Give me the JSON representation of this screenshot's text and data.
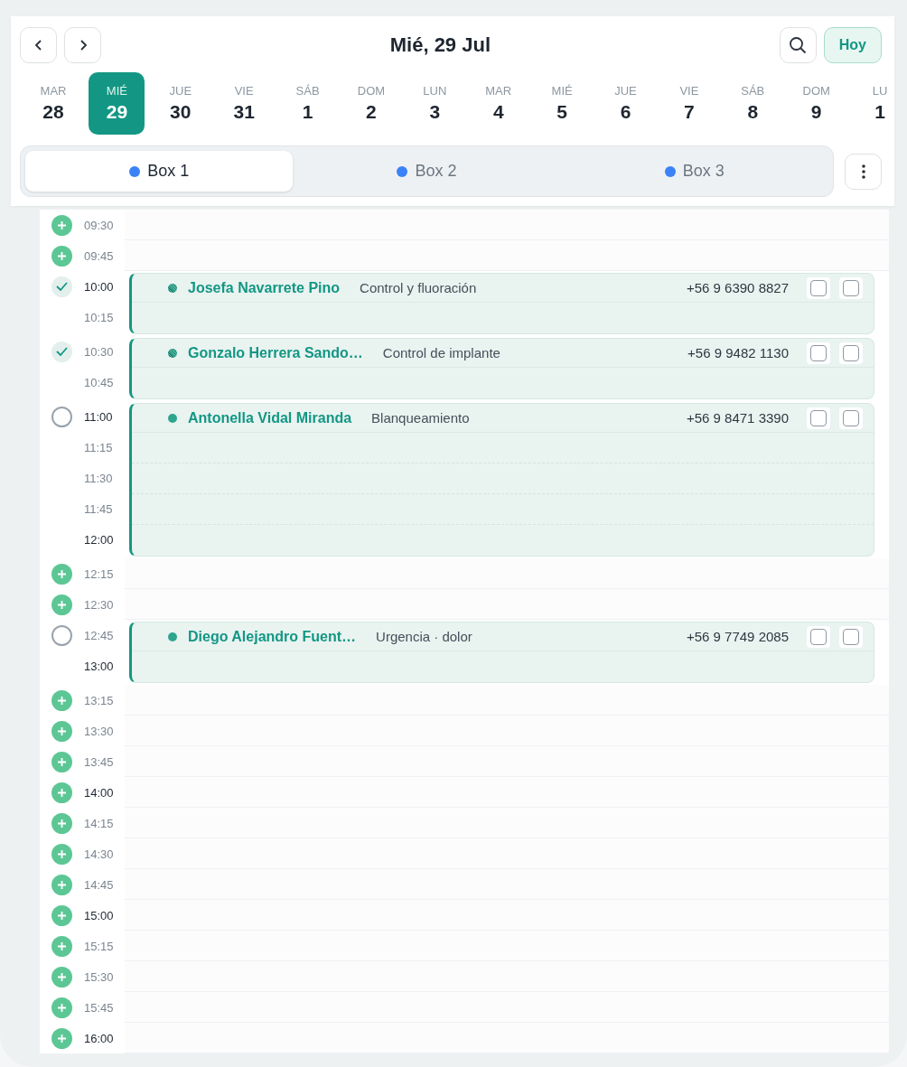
{
  "header": {
    "title": "Mié, 29 Jul",
    "today_button": "Hoy"
  },
  "days": [
    {
      "weekday": "MAR",
      "day": "28",
      "selected": false
    },
    {
      "weekday": "MIÉ",
      "day": "29",
      "selected": true
    },
    {
      "weekday": "JUE",
      "day": "30",
      "selected": false
    },
    {
      "weekday": "VIE",
      "day": "31",
      "selected": false
    },
    {
      "weekday": "SÁB",
      "day": "1",
      "selected": false
    },
    {
      "weekday": "DOM",
      "day": "2",
      "selected": false
    },
    {
      "weekday": "LUN",
      "day": "3",
      "selected": false
    },
    {
      "weekday": "MAR",
      "day": "4",
      "selected": false
    },
    {
      "weekday": "MIÉ",
      "day": "5",
      "selected": false
    },
    {
      "weekday": "JUE",
      "day": "6",
      "selected": false
    },
    {
      "weekday": "VIE",
      "day": "7",
      "selected": false
    },
    {
      "weekday": "SÁB",
      "day": "8",
      "selected": false
    },
    {
      "weekday": "DOM",
      "day": "9",
      "selected": false
    },
    {
      "weekday": "LU",
      "day": "1",
      "selected": false
    }
  ],
  "boxes": [
    {
      "label": "Box 1",
      "selected": true
    },
    {
      "label": "Box 2",
      "selected": false
    },
    {
      "label": "Box 3",
      "selected": false
    }
  ],
  "schedule": [
    {
      "kind": "free",
      "time": "09:30",
      "strong": false
    },
    {
      "kind": "free",
      "time": "09:45",
      "strong": false
    },
    {
      "kind": "appointment",
      "confirmed": true,
      "name": "Josefa Navarrete Pino",
      "reason": "Control y fluoración",
      "phone": "+56 9 6390 8827",
      "flags": [
        {
          "checked": false
        },
        {
          "checked": false
        }
      ],
      "times": [
        {
          "time": "10:00",
          "strong": true
        },
        {
          "time": "10:15",
          "strong": false
        }
      ]
    },
    {
      "kind": "appointment",
      "confirmed": true,
      "name": "Gonzalo Herrera Sando…",
      "reason": "Control de implante",
      "phone": "+56 9 9482 1130",
      "flags": [
        {
          "checked": false
        },
        {
          "checked": false
        }
      ],
      "times": [
        {
          "time": "10:30",
          "strong": false
        },
        {
          "time": "10:45",
          "strong": false
        }
      ]
    },
    {
      "kind": "appointment",
      "confirmed": false,
      "name": "Antonella Vidal Miranda",
      "reason": "Blanqueamiento",
      "phone": "+56 9 8471 3390",
      "flags": [
        {
          "checked": false
        },
        {
          "checked": false
        }
      ],
      "times": [
        {
          "time": "11:00",
          "strong": true
        },
        {
          "time": "11:15",
          "strong": false
        },
        {
          "time": "11:30",
          "strong": false
        },
        {
          "time": "11:45",
          "strong": false
        },
        {
          "time": "12:00",
          "strong": true
        }
      ]
    },
    {
      "kind": "free",
      "time": "12:15",
      "strong": false
    },
    {
      "kind": "free",
      "time": "12:30",
      "strong": false
    },
    {
      "kind": "appointment",
      "confirmed": false,
      "name": "Diego Alejandro Fuent…",
      "reason": "Urgencia · dolor",
      "phone": "+56 9 7749 2085",
      "flags": [
        {
          "checked": false
        },
        {
          "checked": false
        }
      ],
      "times": [
        {
          "time": "12:45",
          "strong": false
        },
        {
          "time": "13:00",
          "strong": true
        }
      ]
    },
    {
      "kind": "free",
      "time": "13:15",
      "strong": false
    },
    {
      "kind": "free",
      "time": "13:30",
      "strong": false
    },
    {
      "kind": "free",
      "time": "13:45",
      "strong": false
    },
    {
      "kind": "free",
      "time": "14:00",
      "strong": true
    },
    {
      "kind": "free",
      "time": "14:15",
      "strong": false
    },
    {
      "kind": "free",
      "time": "14:30",
      "strong": false
    },
    {
      "kind": "free",
      "time": "14:45",
      "strong": false
    },
    {
      "kind": "free",
      "time": "15:00",
      "strong": true
    },
    {
      "kind": "free",
      "time": "15:15",
      "strong": false
    },
    {
      "kind": "free",
      "time": "15:30",
      "strong": false
    },
    {
      "kind": "free",
      "time": "15:45",
      "strong": false
    },
    {
      "kind": "free",
      "time": "16:00",
      "strong": true
    }
  ]
}
